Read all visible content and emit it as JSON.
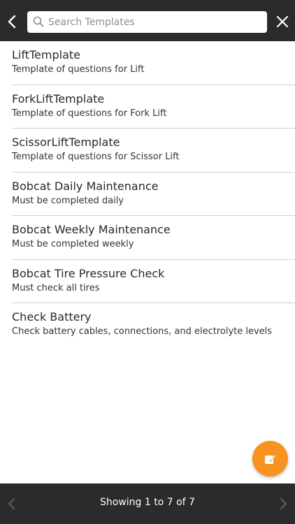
{
  "header": {
    "search": {
      "placeholder": "Search Templates",
      "value": ""
    },
    "back_icon": "chevron-left-icon",
    "close_icon": "close-icon"
  },
  "templates": [
    {
      "title": "LiftTemplate",
      "subtitle": "Template of questions for Lift"
    },
    {
      "title": "ForkLiftTemplate",
      "subtitle": "Template of questions for Fork Lift"
    },
    {
      "title": "ScissorLiftTemplate",
      "subtitle": "Template of questions for Scissor Lift"
    },
    {
      "title": "Bobcat Daily Maintenance",
      "subtitle": "Must be completed daily"
    },
    {
      "title": "Bobcat Weekly Maintenance",
      "subtitle": "Must be completed weekly"
    },
    {
      "title": "Bobcat Tire Pressure Check",
      "subtitle": "Must check all tires"
    },
    {
      "title": "Check Battery",
      "subtitle": "Check battery cables, connections, and electrolyte levels"
    }
  ],
  "fab": {
    "icon": "edit-icon",
    "color": "#f7931e"
  },
  "footer": {
    "pager_text": "Showing 1 to 7 of 7",
    "prev_icon": "chevron-left-icon",
    "next_icon": "chevron-right-icon",
    "bar_color": "#2b2b2d"
  }
}
